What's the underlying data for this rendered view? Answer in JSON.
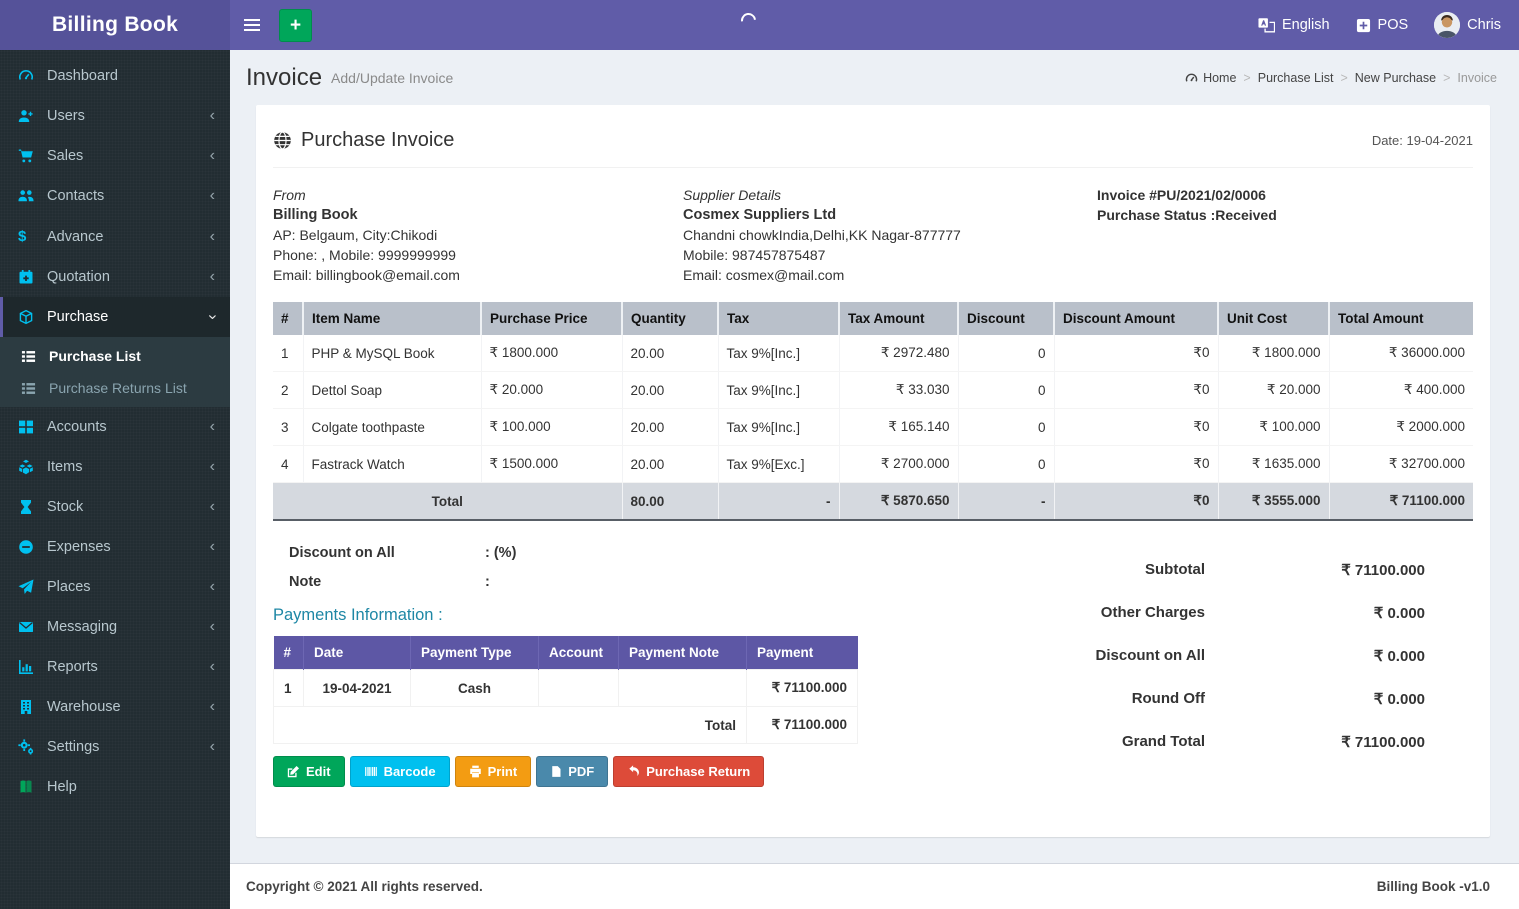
{
  "app": {
    "brand": "Billing Book",
    "footer_left": "Copyright © 2021 All rights reserved.",
    "footer_right": "Billing Book -v1.0"
  },
  "header": {
    "add_button": "+",
    "language_label": "English",
    "pos_label": "POS",
    "user_name": "Chris"
  },
  "sidebar": {
    "items": [
      {
        "label": "Dashboard",
        "icon": "gauge-icon"
      },
      {
        "label": "Users",
        "icon": "user-plus-icon"
      },
      {
        "label": "Sales",
        "icon": "cart-icon"
      },
      {
        "label": "Contacts",
        "icon": "group-icon"
      },
      {
        "label": "Advance",
        "icon": "dollar-icon"
      },
      {
        "label": "Quotation",
        "icon": "calendar-plus-icon"
      },
      {
        "label": "Purchase",
        "icon": "cube-icon"
      },
      {
        "label": "Accounts",
        "icon": "grid-icon"
      },
      {
        "label": "Items",
        "icon": "cubes-icon"
      },
      {
        "label": "Stock",
        "icon": "hourglass-icon"
      },
      {
        "label": "Expenses",
        "icon": "minus-circle-icon"
      },
      {
        "label": "Places",
        "icon": "paper-plane-icon"
      },
      {
        "label": "Messaging",
        "icon": "envelope-icon"
      },
      {
        "label": "Reports",
        "icon": "bar-chart-icon"
      },
      {
        "label": "Warehouse",
        "icon": "building-icon"
      },
      {
        "label": "Settings",
        "icon": "gears-icon"
      },
      {
        "label": "Help",
        "icon": "book-icon"
      }
    ],
    "purchase_children": [
      {
        "label": "Purchase List"
      },
      {
        "label": "Purchase Returns List"
      }
    ]
  },
  "page": {
    "title": "Invoice",
    "subtitle": "Add/Update Invoice",
    "breadcrumb": [
      {
        "label": "Home"
      },
      {
        "label": "Purchase List"
      },
      {
        "label": "New Purchase"
      },
      {
        "label": "Invoice"
      }
    ]
  },
  "invoice": {
    "card_title": "Purchase Invoice",
    "date": "Date: 19-04-2021",
    "from": {
      "heading": "From",
      "name": "Billing Book",
      "line1": "AP: Belgaum, City:Chikodi",
      "line2": "Phone: , Mobile: 9999999999",
      "line3": "Email: billingbook@email.com"
    },
    "supplier": {
      "heading": "Supplier Details",
      "name": "Cosmex Suppliers Ltd",
      "line1": "Chandni chowkIndia,Delhi,KK Nagar-877777",
      "line2": "Mobile: 987457875487",
      "line3": "Email: cosmex@mail.com"
    },
    "meta": {
      "number": "Invoice #PU/2021/02/0006",
      "status": "Purchase Status :Received"
    },
    "items_table": {
      "headers": [
        "#",
        "Item Name",
        "Purchase Price",
        "Quantity",
        "Tax",
        "Tax Amount",
        "Discount",
        "Discount Amount",
        "Unit Cost",
        "Total Amount"
      ],
      "rows": [
        [
          "1",
          "PHP & MySQL Book",
          "₹ 1800.000",
          "20.00",
          "Tax 9%[Inc.]",
          "₹ 2972.480",
          "0",
          "₹0",
          "₹ 1800.000",
          "₹ 36000.000"
        ],
        [
          "2",
          "Dettol Soap",
          "₹ 20.000",
          "20.00",
          "Tax 9%[Inc.]",
          "₹ 33.030",
          "0",
          "₹0",
          "₹ 20.000",
          "₹ 400.000"
        ],
        [
          "3",
          "Colgate toothpaste",
          "₹ 100.000",
          "20.00",
          "Tax 9%[Inc.]",
          "₹ 165.140",
          "0",
          "₹0",
          "₹ 100.000",
          "₹ 2000.000"
        ],
        [
          "4",
          "Fastrack Watch",
          "₹ 1500.000",
          "20.00",
          "Tax 9%[Exc.]",
          "₹ 2700.000",
          "0",
          "₹0",
          "₹ 1635.000",
          "₹ 32700.000"
        ]
      ],
      "total_row": [
        "Total",
        "80.00",
        "-",
        "₹ 5870.650",
        "-",
        "₹0",
        "₹ 3555.000",
        "₹ 71100.000"
      ]
    },
    "discount_label": "Discount on All",
    "discount_value": ": (%)",
    "note_label": "Note",
    "note_value": ":",
    "payments": {
      "heading": "Payments Information :",
      "headers": [
        "#",
        "Date",
        "Payment Type",
        "Account",
        "Payment Note",
        "Payment"
      ],
      "rows": [
        [
          "1",
          "19-04-2021",
          "Cash",
          "",
          "",
          "₹ 71100.000"
        ]
      ],
      "total_label": "Total",
      "total_value": "₹ 71100.000"
    },
    "summary": [
      {
        "label": "Subtotal",
        "value": "₹ 71100.000"
      },
      {
        "label": "Other Charges",
        "value": "₹ 0.000"
      },
      {
        "label": "Discount on All",
        "value": "₹ 0.000"
      },
      {
        "label": "Round Off",
        "value": "₹ 0.000"
      },
      {
        "label": "Grand Total",
        "value": "₹ 71100.000"
      }
    ],
    "actions": [
      {
        "label": "Edit",
        "color": "#00a65a"
      },
      {
        "label": "Barcode",
        "color": "#00c0ef"
      },
      {
        "label": "Print",
        "color": "#f39c12"
      },
      {
        "label": "PDF",
        "color": "#4a89ab"
      },
      {
        "label": "Purchase Return",
        "color": "#dd4b39"
      }
    ]
  },
  "theme": {
    "navbar": "#605ca8",
    "logo_bg": "#555299",
    "sidebar_bg": "#222d32",
    "sidebar_active_bg": "#1e282c",
    "submenu_bg": "#2c3b41",
    "sidebar_icon": "#00c0ef",
    "items_table_header": "#b9c0ca",
    "payments_table_header": "#5d57a5",
    "content_bg": "#ecf0f5",
    "payments_heading": "#1e87a5"
  }
}
